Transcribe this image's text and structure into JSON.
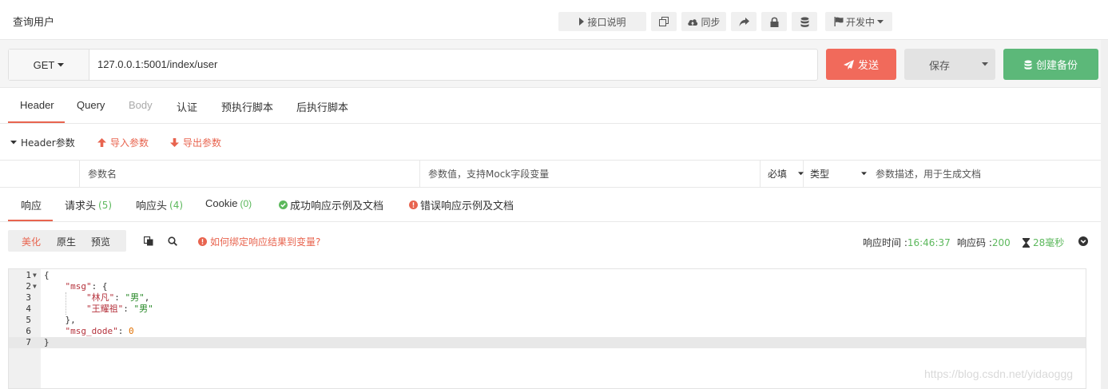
{
  "header": {
    "title": "查询用户",
    "buttons": {
      "doc": "接口说明",
      "sync": "同步",
      "status": "开发中"
    }
  },
  "request": {
    "method": "GET",
    "url": "127.0.0.1:5001/index/user",
    "send": "发送",
    "save": "保存",
    "backup": "创建备份"
  },
  "req_tabs": [
    "Header",
    "Query",
    "Body",
    "认证",
    "预执行脚本",
    "后执行脚本"
  ],
  "params": {
    "section": "Header参数",
    "import": "导入参数",
    "export": "导出参数",
    "col_name": "参数名",
    "col_value": "参数值，支持Mock字段变量",
    "col_required": "必填",
    "col_type": "类型",
    "col_desc": "参数描述，用于生成文档"
  },
  "resp_tabs": {
    "response": "响应",
    "req_headers": "请求头",
    "req_headers_count": "(5)",
    "resp_headers": "响应头",
    "resp_headers_count": "(4)",
    "cookie": "Cookie",
    "cookie_count": "(0)",
    "success_doc": "成功响应示例及文档",
    "error_doc": "错误响应示例及文档"
  },
  "view": {
    "pretty": "美化",
    "raw": "原生",
    "preview": "预览",
    "bind_hint": "如何绑定响应结果到变量?",
    "time_label": "响应时间 : ",
    "time_value": "16:46:37",
    "code_label": "响应码 : ",
    "code_value": "200",
    "duration": "28毫秒"
  },
  "code_lines": [
    {
      "num": "1",
      "text": "{"
    },
    {
      "num": "2",
      "text": "    \"msg\": {"
    },
    {
      "num": "3",
      "text": "        \"林凡\": \"男\","
    },
    {
      "num": "4",
      "text": "        \"王耀祖\": \"男\""
    },
    {
      "num": "5",
      "text": "    },"
    },
    {
      "num": "6",
      "text": "    \"msg_dode\": 0"
    },
    {
      "num": "7",
      "text": "}"
    }
  ],
  "watermark": "https://blog.csdn.net/yidaoggg",
  "colors": {
    "send": "#f16a5b",
    "backup": "#5cb879",
    "accent_red": "#e8644f",
    "count_green": "#5cb85c"
  }
}
